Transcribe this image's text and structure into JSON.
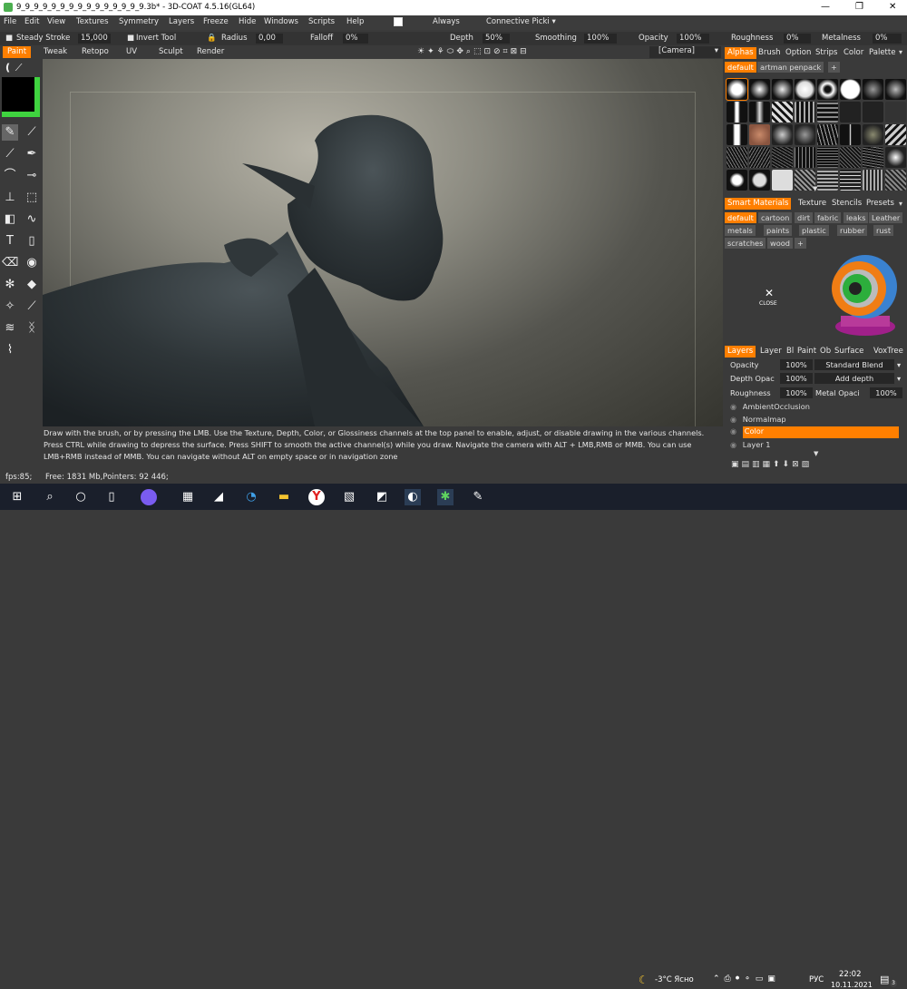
{
  "window": {
    "title": "9_9_9_9_9_9_9_9_9_9_9_9_9_9_9.3b* - 3D-COAT 4.5.16(GL64)",
    "min": "—",
    "max": "❐",
    "close": "✕"
  },
  "menu": {
    "items": [
      "File",
      "Edit",
      "View",
      "Textures",
      "Symmetry",
      "Layers",
      "Freeze",
      "Hide",
      "Windows",
      "Scripts",
      "Help"
    ],
    "always": "Always",
    "connective": "Connective Picki"
  },
  "toolbar": {
    "steady": "Steady Stroke",
    "steady_val": "15,000",
    "invert": "Invert Tool",
    "radius": "Radius",
    "radius_val": "0,00",
    "falloff": "Falloff",
    "falloff_val": "0%",
    "depth": "Depth",
    "depth_val": "50%",
    "smoothing": "Smoothing",
    "smoothing_val": "100%",
    "opacity": "Opacity",
    "opacity_val": "100%",
    "roughness": "Roughness",
    "roughness_val": "0%",
    "metalness": "Metalness",
    "metalness_val": "0%"
  },
  "tabs": [
    "Paint",
    "Tweak",
    "Retopo",
    "UV",
    "Sculpt",
    "Render"
  ],
  "camera": "[Camera]",
  "hint": "Draw with the brush, or by pressing the LMB. Use the Texture, Depth, Color, or Glossiness channels at the top panel to enable, adjust, or disable drawing in the various channels. Press CTRL while drawing to depress the surface. Press SHIFT to smooth the active channel(s) while you draw. Navigate the camera with ALT + LMB,RMB or MMB. You can use LMB+RMB instead of MMB. You can navigate without ALT on empty space or in navigation zone",
  "status": {
    "fps": "fps:85;",
    "free": "Free: 1831 Mb,Pointers: 92 446;"
  },
  "right": {
    "tabs": [
      "Alphas",
      "Brush",
      "Option",
      "Strips",
      "Color",
      "Palette"
    ],
    "alpha_presets": [
      "default",
      "artman penpack"
    ],
    "sm_tabs": [
      "Smart Materials",
      "Texture",
      "Stencils",
      "Presets"
    ],
    "sm_tags1": [
      "default",
      "cartoon",
      "dirt",
      "fabric",
      "leaks",
      "Leather"
    ],
    "sm_tags2": [
      "metals",
      "paints",
      "plastic",
      "rubber",
      "rust"
    ],
    "sm_tags3": [
      "scratches",
      "wood"
    ],
    "close": "CLOSE",
    "layer_tabs": [
      "Layers",
      "Layer",
      "Bl",
      "Paint",
      "Ob",
      "Surface",
      "VoxTree"
    ],
    "opacity_label": "Opacity",
    "opacity_val": "100%",
    "blend": "Standard Blend",
    "depth_label": "Depth Opac",
    "depth_val": "100%",
    "depth_mode": "Add depth",
    "rough_label": "Roughness",
    "rough_val": "100%",
    "metal_label": "Metal Opaci",
    "metal_val": "100%",
    "layers": [
      "AmbientOcclusion",
      "Normalmap",
      "Color",
      "Layer 1"
    ],
    "active_layer": "Color"
  },
  "taskbar": {
    "weather": "-3°C Ясно",
    "lang": "РУС",
    "time": "22:02",
    "date": "10.11.2021",
    "notif": "3"
  },
  "colors": {
    "accent": "#ff7f00",
    "green": "#3fd43f"
  }
}
